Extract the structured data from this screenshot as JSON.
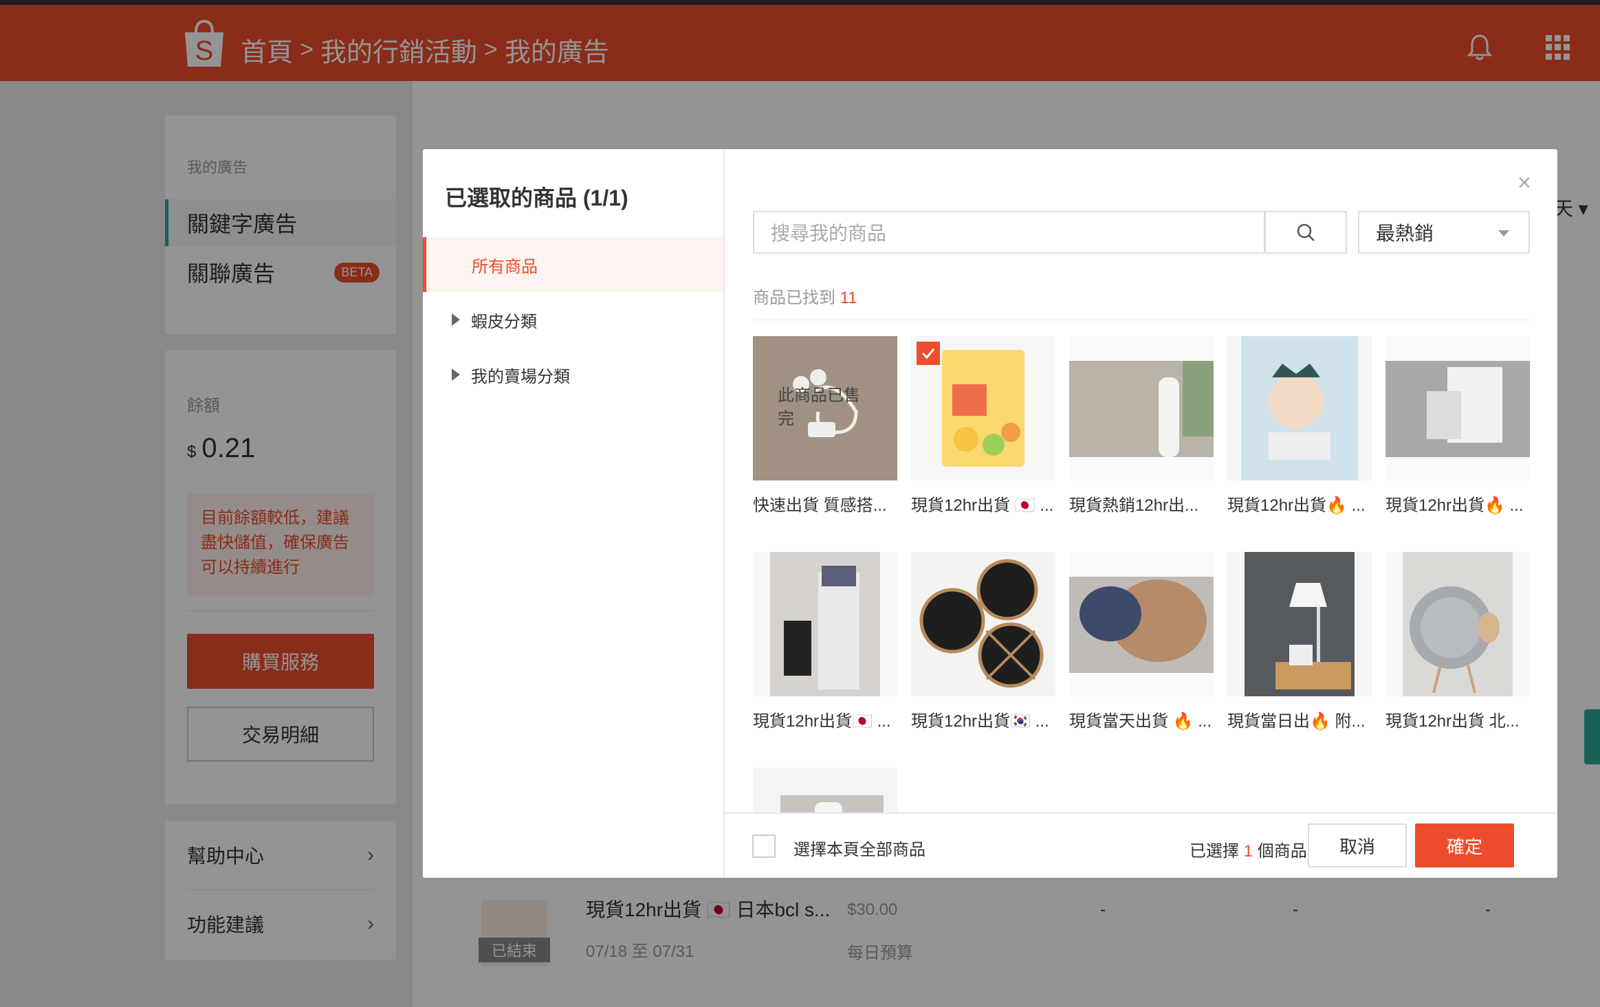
{
  "header": {
    "breadcrumbs": [
      "首頁",
      "我的行銷活動",
      "我的廣告"
    ],
    "separator": ">"
  },
  "sidebar": {
    "section_title": "我的廣告",
    "items": [
      {
        "label": "關鍵字廣告",
        "active": true
      },
      {
        "label": "關聯廣告",
        "badge": "BETA"
      }
    ]
  },
  "balance": {
    "label": "餘額",
    "currency": "$",
    "amount": "0.21",
    "warning": "目前餘額較低，建議盡快儲值，確保廣告可以持續進行",
    "buy_label": "購買服務",
    "transactions_label": "交易明細"
  },
  "help": {
    "items": [
      {
        "label": "幫助中心"
      },
      {
        "label": "功能建議"
      }
    ],
    "chevron": "›"
  },
  "background": {
    "tab_fragment": "天",
    "ended_badge": "已結束",
    "product_name": "現貨12hr出貨 🇯🇵 日本bcl s...",
    "price": "$30.00",
    "date_range": "07/18 至 07/31",
    "budget_label": "每日預算",
    "dash": "-"
  },
  "modal": {
    "title": "已選取的商品 (1/1)",
    "categories": [
      {
        "label": "所有商品",
        "active": true
      },
      {
        "label": "蝦皮分類",
        "expandable": true
      },
      {
        "label": "我的賣場分類",
        "expandable": true
      }
    ],
    "search_placeholder": "搜尋我的商品",
    "sort_value": "最熱銷",
    "found_label": "商品已找到",
    "found_count": "11",
    "sold_out_text": "此商品已售完",
    "products": [
      {
        "name": "快速出貨 質感搭...",
        "sold_out": true,
        "selected": false
      },
      {
        "name": "現貨12hr出貨 🇯🇵 ...",
        "selected": true
      },
      {
        "name": "現貨熱銷12hr出...",
        "selected": false
      },
      {
        "name": "現貨12hr出貨🔥 ...",
        "selected": false
      },
      {
        "name": "現貨12hr出貨🔥 ...",
        "selected": false
      },
      {
        "name": "現貨12hr出貨🇯🇵 ...",
        "selected": false
      },
      {
        "name": "現貨12hr出貨🇰🇷 ...",
        "selected": false
      },
      {
        "name": "現貨當天出貨 🔥 ...",
        "selected": false
      },
      {
        "name": "現貨當日出🔥 附...",
        "selected": false
      },
      {
        "name": "現貨12hr出貨 北...",
        "selected": false
      },
      {
        "name": "",
        "selected": false
      }
    ],
    "footer": {
      "select_all_label": "選擇本頁全部商品",
      "selected_prefix": "已選擇",
      "selected_count": "1",
      "selected_suffix": "個商品",
      "cancel_label": "取消",
      "confirm_label": "確定"
    }
  },
  "colors": {
    "brand": "#ee4d2d",
    "accent_green": "#26aa99"
  }
}
